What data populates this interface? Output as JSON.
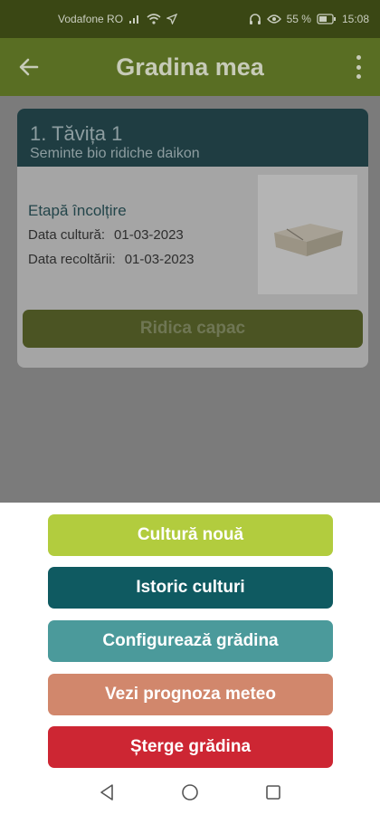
{
  "status_bar": {
    "carrier": "Vodafone RO",
    "battery": "55 %",
    "time": "15:08"
  },
  "app_bar": {
    "title": "Gradina mea",
    "icons": {
      "back": "arrow-left-icon",
      "more": "more-vertical-icon"
    }
  },
  "tray": {
    "title": "1. Tăvița 1",
    "subtitle": "Seminte bio ridiche daikon",
    "stage": "Etapă încolțire",
    "culture_date_label": "Data cultură:",
    "culture_date": "01-03-2023",
    "harvest_date_label": "Data recoltării:",
    "harvest_date": "01-03-2023",
    "lift_button": "Ridica capac"
  },
  "sheet": {
    "buttons": [
      {
        "label": "Cultură nouă",
        "color": "#b2cc3e"
      },
      {
        "label": "Istoric culturi",
        "color": "#0f5a61"
      },
      {
        "label": "Configurează grădina",
        "color": "#4b9a9b"
      },
      {
        "label": "Vezi prognoza meteo",
        "color": "#d1876c"
      },
      {
        "label": "Șterge grădina",
        "color": "#cd2633"
      }
    ]
  },
  "nav": {
    "icons": [
      "back-triangle-icon",
      "home-circle-icon",
      "recents-square-icon"
    ]
  },
  "colors": {
    "app_bar": "#596e23",
    "status_bar": "#3a4714",
    "scrim": "#7b7b7b"
  }
}
